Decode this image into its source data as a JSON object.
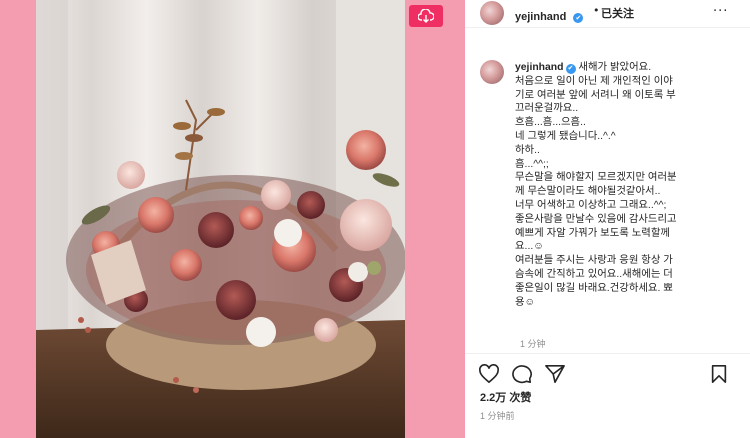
{
  "header": {
    "username": "yejinhand",
    "verified_mark": "✔",
    "separator": "•",
    "follow_status": "已关注",
    "more": "···"
  },
  "caption": {
    "username": "yejinhand",
    "verified_mark": "✔",
    "lines": [
      " 새해가 밝았어요.",
      "처음으로 일이 아닌 제 개인적인 이야",
      "기로 여러분 앞에 서려니 왜 이토록 부",
      "끄러운걸까요..",
      "흐흠...흠...으흠..",
      "네 그렇게 됐습니다..^.^",
      "하하..",
      "흠...^^;;",
      "무슨말을 해야할지 모르겠지만 여러분",
      "께 무슨말이라도 해야될것같아서..",
      "너무 어색하고 이상하고 그래요..^^;",
      "좋은사람을 만날수 있음에 감사드리고",
      "예쁘게 자알 가꿔가 보도록 노력할께",
      "요...☺",
      "여러분들 주시는 사랑과 응원 항상 가",
      "슴속에 간직하고 있어요..새해에는 더",
      "좋은일이 많길 바래요.건강하세요. 뾰",
      "용☺"
    ],
    "time": "1 分钟"
  },
  "actions": {
    "like_icon": "heart-outline",
    "comment_icon": "speech-bubble",
    "share_icon": "paper-plane",
    "save_icon": "bookmark"
  },
  "likes": "2.2万 次赞",
  "post_time": "1 分钟前",
  "colors": {
    "pink_frame": "#f49db0",
    "download_button": "#ef2f63",
    "verified_blue": "#3897f0"
  }
}
